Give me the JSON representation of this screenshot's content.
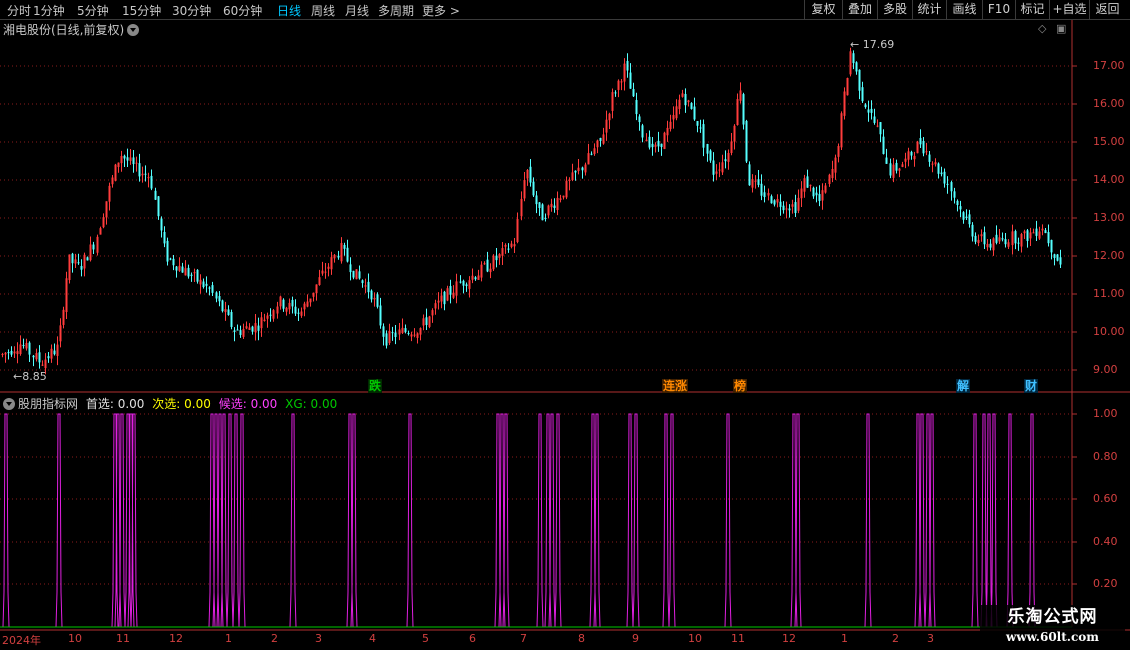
{
  "toolbar": {
    "periods": [
      "分时",
      "1分钟",
      "5分钟",
      "15分钟",
      "30分钟",
      "60分钟",
      "日线",
      "周线",
      "月线",
      "多周期",
      "更多 >"
    ],
    "active_period": "日线",
    "buttons": [
      "复权",
      "叠加",
      "多股",
      "统计",
      "画线",
      "F10",
      "标记",
      "+自选",
      "返回"
    ]
  },
  "main_chart": {
    "title": "湘电股份(日线,前复权)",
    "price_ticks": [
      "17.00",
      "16.00",
      "15.00",
      "14.00",
      "13.00",
      "12.00",
      "11.00",
      "10.00",
      "9.00"
    ],
    "high_label": "17.69",
    "low_label": "8.85",
    "markers": [
      {
        "text": "跌",
        "color": "#00c800",
        "bg": "#002a00"
      },
      {
        "text": "连涨",
        "color": "#ff8800",
        "bg": "#402000"
      },
      {
        "text": "榜",
        "color": "#ff8800",
        "bg": "#402000"
      },
      {
        "text": "解",
        "color": "#40c0ff",
        "bg": "#002840"
      },
      {
        "text": "财",
        "color": "#40c0ff",
        "bg": "#002840"
      }
    ],
    "up_color": "#ff3c3c",
    "down_color": "#54ffff"
  },
  "indicator": {
    "name": "股朋指标网",
    "items": [
      {
        "label": "首选:",
        "value": "0.00",
        "color": "#e0e0e0"
      },
      {
        "label": "次选:",
        "value": "0.00",
        "color": "#ffff00"
      },
      {
        "label": "候选:",
        "value": "0.00",
        "color": "#ff40ff"
      },
      {
        "label": "XG:",
        "value": "0.00",
        "color": "#00c800"
      }
    ],
    "ticks": [
      "1.00",
      "0.80",
      "0.60",
      "0.40",
      "0.20"
    ],
    "signal_color": "#e020e0",
    "baseline_color": "#00c800"
  },
  "date_axis": [
    "2024年",
    "10",
    "11",
    "12",
    "1",
    "2",
    "3",
    "4",
    "5",
    "6",
    "7",
    "8",
    "9",
    "10",
    "11",
    "12",
    "1",
    "2",
    "3"
  ],
  "watermark": {
    "title": "乐淘公式网",
    "url": "www.60lt.com"
  }
}
